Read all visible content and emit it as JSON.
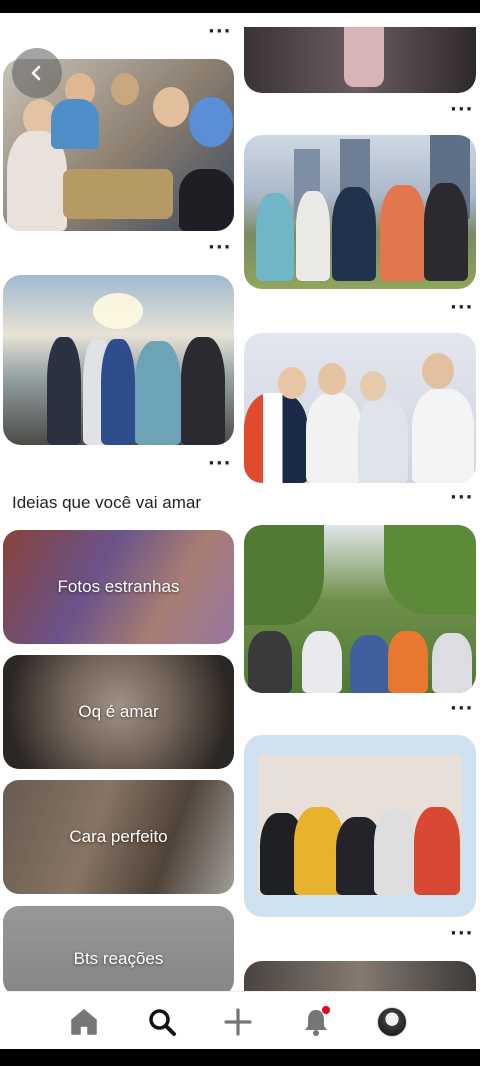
{
  "section_title": "Ideias que você vai amar",
  "ideas": [
    {
      "label": "Fotos estranhas"
    },
    {
      "label": "Oq é amar"
    },
    {
      "label": "Cara perfeito"
    },
    {
      "label": "Bts reações"
    }
  ],
  "more_dots": "···",
  "icons": {
    "back": "chevron-left-icon",
    "home": "home-icon",
    "search": "search-icon",
    "create": "plus-icon",
    "notifications": "bell-icon",
    "profile": "avatar"
  },
  "colors": {
    "notification_badge": "#e60023",
    "active_icon": "#111111",
    "inactive_icon": "#767676"
  }
}
